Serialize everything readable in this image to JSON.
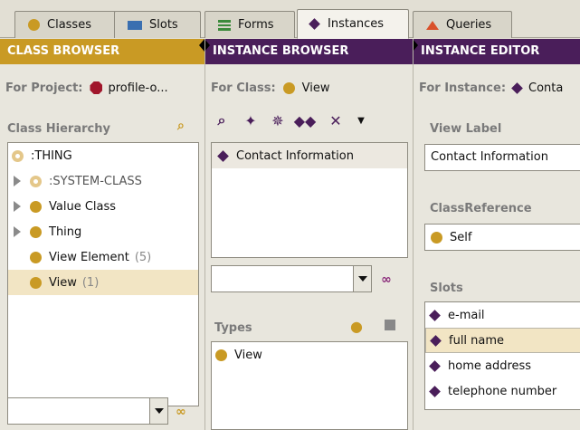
{
  "tabs": [
    {
      "label": "Classes",
      "icon": "class-icon"
    },
    {
      "label": "Slots",
      "icon": "slot-icon"
    },
    {
      "label": "Forms",
      "icon": "form-icon"
    },
    {
      "label": "Instances",
      "icon": "instance-icon"
    },
    {
      "label": "Queries",
      "icon": "query-icon"
    }
  ],
  "active_tab": "Instances",
  "class_browser": {
    "header": "CLASS BROWSER",
    "project_label": "For Project:",
    "project_name": "profile-o...",
    "hierarchy_label": "Class Hierarchy",
    "tree": [
      {
        "label": ":THING",
        "count": ""
      },
      {
        "label": ":SYSTEM-CLASS",
        "count": ""
      },
      {
        "label": "Value Class",
        "count": ""
      },
      {
        "label": "Thing",
        "count": ""
      },
      {
        "label": "View Element",
        "count": "(5)"
      },
      {
        "label": "View",
        "count": "(1)"
      }
    ],
    "search_value": ""
  },
  "instance_browser": {
    "header": "INSTANCE BROWSER",
    "class_label": "For Class:",
    "class_name": "View",
    "instances": [
      "Contact Information"
    ],
    "search_value": "",
    "types_label": "Types",
    "types": [
      "View"
    ]
  },
  "instance_editor": {
    "header": "INSTANCE EDITOR",
    "instance_label": "For Instance:",
    "instance_name": "Conta",
    "view_label_label": "View Label",
    "view_label_value": "Contact Information",
    "class_reference_label": "ClassReference",
    "class_reference_value": "Self",
    "slots_label": "Slots",
    "slots": [
      "e-mail",
      "full name",
      "home address",
      "telephone number"
    ]
  },
  "colors": {
    "class_accent": "#c99a24",
    "instance_accent": "#4a1e5a",
    "project_accent": "#a0162b"
  }
}
